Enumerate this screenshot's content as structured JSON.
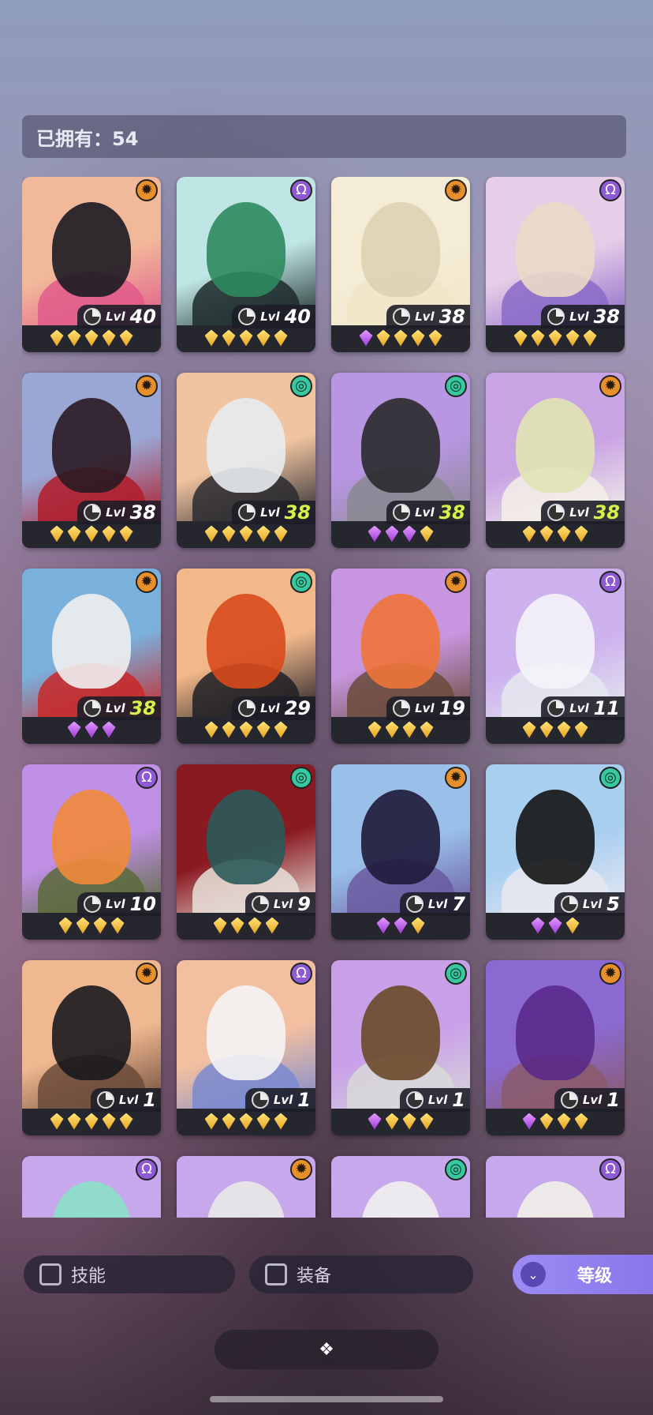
{
  "header": {
    "owned_label": "已拥有：54"
  },
  "level_prefix": "Lvl",
  "colors": {
    "gold_gem": "#f2c14a",
    "purple_gem": "#c064ef",
    "highlight_level": "#d8f04a",
    "sort_button": "#9584f0"
  },
  "cards": [
    {
      "faction": "sun-icon",
      "level": "40",
      "highlight": false,
      "gems": [
        "gold",
        "gold",
        "gold",
        "gold",
        "gold"
      ],
      "bg": [
        "#f2b89a",
        "#1b1b22",
        "#e05a8a"
      ]
    },
    {
      "faction": "omega-icon",
      "level": "40",
      "highlight": false,
      "gems": [
        "gold",
        "gold",
        "gold",
        "gold",
        "gold"
      ],
      "bg": [
        "#bfe6e4",
        "#2e8a5e",
        "#1d2a2a"
      ]
    },
    {
      "faction": "sun-icon",
      "level": "38",
      "highlight": false,
      "gems": [
        "purple",
        "gold",
        "gold",
        "gold",
        "gold"
      ],
      "bg": [
        "#f5ecd6",
        "#ddd3b4",
        "#f0e6c8"
      ]
    },
    {
      "faction": "omega-icon",
      "level": "38",
      "highlight": false,
      "gems": [
        "gold",
        "gold",
        "gold",
        "gold",
        "gold"
      ],
      "bg": [
        "#e8cde8",
        "#ecd9c8",
        "#8a6ac8"
      ]
    },
    {
      "faction": "sun-icon",
      "level": "38",
      "highlight": false,
      "gems": [
        "gold",
        "gold",
        "gold",
        "gold",
        "gold"
      ],
      "bg": [
        "#9aa6d4",
        "#2a1a22",
        "#b01c2a"
      ]
    },
    {
      "faction": "spiral-icon",
      "level": "38",
      "highlight": true,
      "gems": [
        "gold",
        "gold",
        "gold",
        "gold",
        "gold"
      ],
      "bg": [
        "#f0c4a0",
        "#e8ecef",
        "#2a2a30"
      ]
    },
    {
      "faction": "spiral-icon",
      "level": "38",
      "highlight": true,
      "gems": [
        "purple",
        "purple",
        "purple",
        "gold"
      ],
      "bg": [
        "#b896e2",
        "#2a2a2e",
        "#8a8890"
      ]
    },
    {
      "faction": "sun-icon",
      "level": "38",
      "highlight": true,
      "gems": [
        "gold",
        "gold",
        "gold",
        "gold"
      ],
      "bg": [
        "#c9a4e4",
        "#e0e4b4",
        "#f4f0e8"
      ]
    },
    {
      "faction": "sun-icon",
      "level": "38",
      "highlight": true,
      "gems": [
        "purple",
        "purple",
        "purple"
      ],
      "bg": [
        "#7ab0dc",
        "#f0f0f0",
        "#c82828"
      ]
    },
    {
      "faction": "spiral-icon",
      "level": "29",
      "highlight": false,
      "gems": [
        "gold",
        "gold",
        "gold",
        "gold",
        "gold"
      ],
      "bg": [
        "#f2b88a",
        "#d84a1c",
        "#1e1e24"
      ]
    },
    {
      "faction": "sun-icon",
      "level": "19",
      "highlight": false,
      "gems": [
        "gold",
        "gold",
        "gold",
        "gold"
      ],
      "bg": [
        "#c896e0",
        "#f07438",
        "#6a4a3a"
      ]
    },
    {
      "faction": "omega-icon",
      "level": "11",
      "highlight": false,
      "gems": [
        "gold",
        "gold",
        "gold",
        "gold"
      ],
      "bg": [
        "#cdb0ee",
        "#f4f4f8",
        "#e4e8ee"
      ]
    },
    {
      "faction": "omega-icon",
      "level": "10",
      "highlight": false,
      "gems": [
        "gold",
        "gold",
        "gold",
        "gold"
      ],
      "bg": [
        "#c090e6",
        "#f08a3a",
        "#5a6a3a"
      ]
    },
    {
      "faction": "spiral-icon",
      "level": "9",
      "highlight": false,
      "gems": [
        "gold",
        "gold",
        "gold",
        "gold"
      ],
      "bg": [
        "#8a1a22",
        "#2a5a5a",
        "#e8e0d8"
      ]
    },
    {
      "faction": "sun-icon",
      "level": "7",
      "highlight": false,
      "gems": [
        "purple",
        "purple",
        "gold"
      ],
      "bg": [
        "#9ac0ea",
        "#1e1a3a",
        "#6a5aa0"
      ]
    },
    {
      "faction": "spiral-icon",
      "level": "5",
      "highlight": false,
      "gems": [
        "purple",
        "purple",
        "gold"
      ],
      "bg": [
        "#a8cef0",
        "#141414",
        "#e8e8f0"
      ]
    },
    {
      "faction": "sun-icon",
      "level": "1",
      "highlight": false,
      "gems": [
        "gold",
        "gold",
        "gold",
        "gold",
        "gold"
      ],
      "bg": [
        "#f0b890",
        "#1a1a1e",
        "#6a4a3a"
      ]
    },
    {
      "faction": "omega-icon",
      "level": "1",
      "highlight": false,
      "gems": [
        "gold",
        "gold",
        "gold",
        "gold",
        "gold"
      ],
      "bg": [
        "#f2c0a0",
        "#f4f4f4",
        "#7a8ad0"
      ]
    },
    {
      "faction": "spiral-icon",
      "level": "1",
      "highlight": false,
      "gems": [
        "purple",
        "gold",
        "gold",
        "gold"
      ],
      "bg": [
        "#c8a0e8",
        "#6a4a2a",
        "#d8d8d8"
      ]
    },
    {
      "faction": "sun-icon",
      "level": "1",
      "highlight": false,
      "gems": [
        "purple",
        "gold",
        "gold",
        "gold"
      ],
      "bg": [
        "#8a6ad0",
        "#5a2a8a",
        "#8a5a6a"
      ]
    },
    {
      "faction": "omega-icon",
      "level": "",
      "highlight": false,
      "gems": [],
      "bg": [
        "#c8a8ec",
        "#8ae0c8",
        "#c8a8ec"
      ]
    },
    {
      "faction": "sun-icon",
      "level": "",
      "highlight": false,
      "gems": [],
      "bg": [
        "#c8a8ec",
        "#e8e8e8",
        "#2a2a2a"
      ]
    },
    {
      "faction": "spiral-icon",
      "level": "",
      "highlight": false,
      "gems": [],
      "bg": [
        "#c8a8ec",
        "#f0f0f0",
        "#2a2a40"
      ]
    },
    {
      "faction": "omega-icon",
      "level": "",
      "highlight": false,
      "gems": [],
      "bg": [
        "#c8a8ec",
        "#f0f0e8",
        "#d8d0c8"
      ]
    }
  ],
  "filters": {
    "skill_label": "技能",
    "equip_label": "装备"
  },
  "sort": {
    "label": "等级"
  }
}
